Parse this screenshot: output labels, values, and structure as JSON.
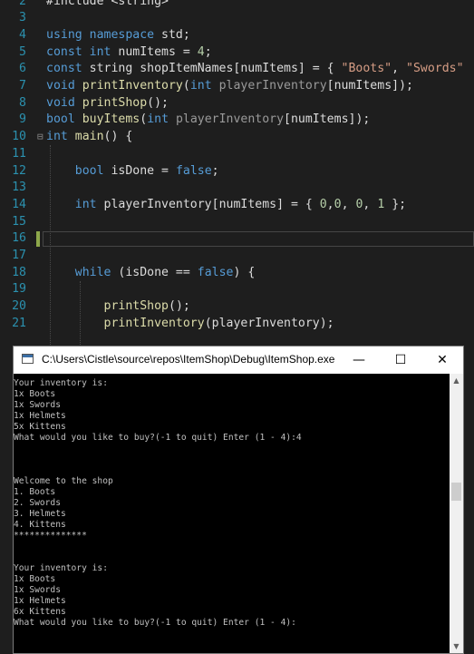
{
  "editor": {
    "lines": [
      {
        "n": "2",
        "parts": [
          [
            "id",
            "#include <string>"
          ]
        ]
      },
      {
        "n": "3",
        "parts": []
      },
      {
        "n": "4",
        "parts": [
          [
            "kw",
            "using "
          ],
          [
            "kw",
            "namespace "
          ],
          [
            "id",
            "std;"
          ]
        ]
      },
      {
        "n": "5",
        "parts": [
          [
            "kw",
            "const "
          ],
          [
            "kw",
            "int "
          ],
          [
            "id",
            "numItems = "
          ],
          [
            "num",
            "4"
          ],
          [
            "id",
            ";"
          ]
        ]
      },
      {
        "n": "6",
        "parts": [
          [
            "kw",
            "const "
          ],
          [
            "id",
            "string shopItemNames[numItems] = { "
          ],
          [
            "str",
            "\"Boots\""
          ],
          [
            "id",
            ", "
          ],
          [
            "str",
            "\"Swords\""
          ]
        ]
      },
      {
        "n": "7",
        "parts": [
          [
            "kw",
            "void "
          ],
          [
            "fn",
            "printInventory"
          ],
          [
            "id",
            "("
          ],
          [
            "kw",
            "int "
          ],
          [
            "param",
            "playerInventory"
          ],
          [
            "id",
            "[numItems]);"
          ]
        ]
      },
      {
        "n": "8",
        "parts": [
          [
            "kw",
            "void "
          ],
          [
            "fn",
            "printShop"
          ],
          [
            "id",
            "();"
          ]
        ]
      },
      {
        "n": "9",
        "parts": [
          [
            "kw",
            "bool "
          ],
          [
            "fn",
            "buyItems"
          ],
          [
            "id",
            "("
          ],
          [
            "kw",
            "int "
          ],
          [
            "param",
            "playerInventory"
          ],
          [
            "id",
            "[numItems]);"
          ]
        ]
      },
      {
        "n": "10",
        "parts": [
          [
            "kw",
            "int "
          ],
          [
            "fn",
            "main"
          ],
          [
            "id",
            "() {"
          ]
        ]
      },
      {
        "n": "11",
        "parts": []
      },
      {
        "n": "12",
        "parts": [
          [
            "id",
            "    "
          ],
          [
            "kw",
            "bool "
          ],
          [
            "id",
            "isDone = "
          ],
          [
            "kw",
            "false"
          ],
          [
            "id",
            ";"
          ]
        ]
      },
      {
        "n": "13",
        "parts": []
      },
      {
        "n": "14",
        "parts": [
          [
            "id",
            "    "
          ],
          [
            "kw",
            "int "
          ],
          [
            "id",
            "playerInventory[numItems] = { "
          ],
          [
            "num",
            "0"
          ],
          [
            "id",
            ","
          ],
          [
            "num",
            "0"
          ],
          [
            "id",
            ", "
          ],
          [
            "num",
            "0"
          ],
          [
            "id",
            ", "
          ],
          [
            "num",
            "1"
          ],
          [
            "id",
            " };"
          ]
        ]
      },
      {
        "n": "15",
        "parts": []
      },
      {
        "n": "16",
        "parts": []
      },
      {
        "n": "17",
        "parts": []
      },
      {
        "n": "18",
        "parts": [
          [
            "id",
            "    "
          ],
          [
            "kw",
            "while "
          ],
          [
            "id",
            "(isDone == "
          ],
          [
            "kw",
            "false"
          ],
          [
            "id",
            ") {"
          ]
        ]
      },
      {
        "n": "19",
        "parts": []
      },
      {
        "n": "20",
        "parts": [
          [
            "id",
            "        "
          ],
          [
            "fn",
            "printShop"
          ],
          [
            "id",
            "();"
          ]
        ]
      },
      {
        "n": "21",
        "parts": [
          [
            "id",
            "        "
          ],
          [
            "fn",
            "printInventory"
          ],
          [
            "id",
            "(playerInventory);"
          ]
        ]
      }
    ]
  },
  "console": {
    "title": "C:\\Users\\Cistle\\source\\repos\\ItemShop\\Debug\\ItemShop.exe",
    "minimize": "—",
    "maximize": "☐",
    "close": "✕",
    "output": [
      "Your inventory is:",
      "1x Boots",
      "1x Swords",
      "1x Helmets",
      "5x Kittens",
      "What would you like to buy?(-1 to quit) Enter (1 - 4):4",
      "",
      "",
      "",
      "Welcome to the shop",
      "1. Boots",
      "2. Swords",
      "3. Helmets",
      "4. Kittens",
      "**************",
      "",
      "",
      "Your inventory is:",
      "1x Boots",
      "1x Swords",
      "1x Helmets",
      "6x Kittens",
      "What would you like to buy?(-1 to quit) Enter (1 - 4):"
    ]
  }
}
